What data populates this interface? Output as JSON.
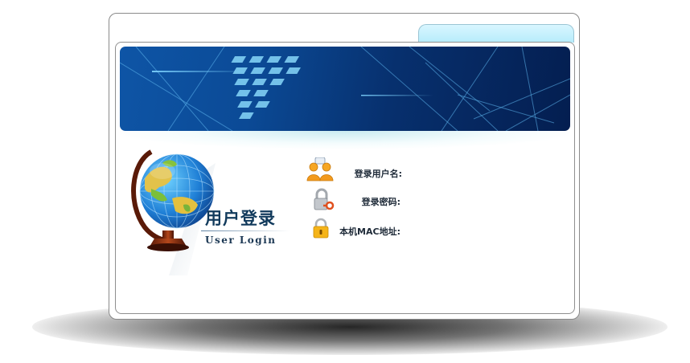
{
  "login_panel": {
    "title_cn": "用户登录",
    "title_en": "User Login"
  },
  "form": {
    "username": {
      "label": "登录用户名:",
      "icon": "users-icon"
    },
    "password": {
      "label": "登录密码:",
      "icon": "key-lock-icon"
    },
    "mac": {
      "label": "本机MAC地址:",
      "icon": "padlock-icon"
    }
  },
  "colors": {
    "banner_start": "#0e55a6",
    "banner_end": "#041e50",
    "tab": "#b6ecfb",
    "title": "#113a5c"
  }
}
